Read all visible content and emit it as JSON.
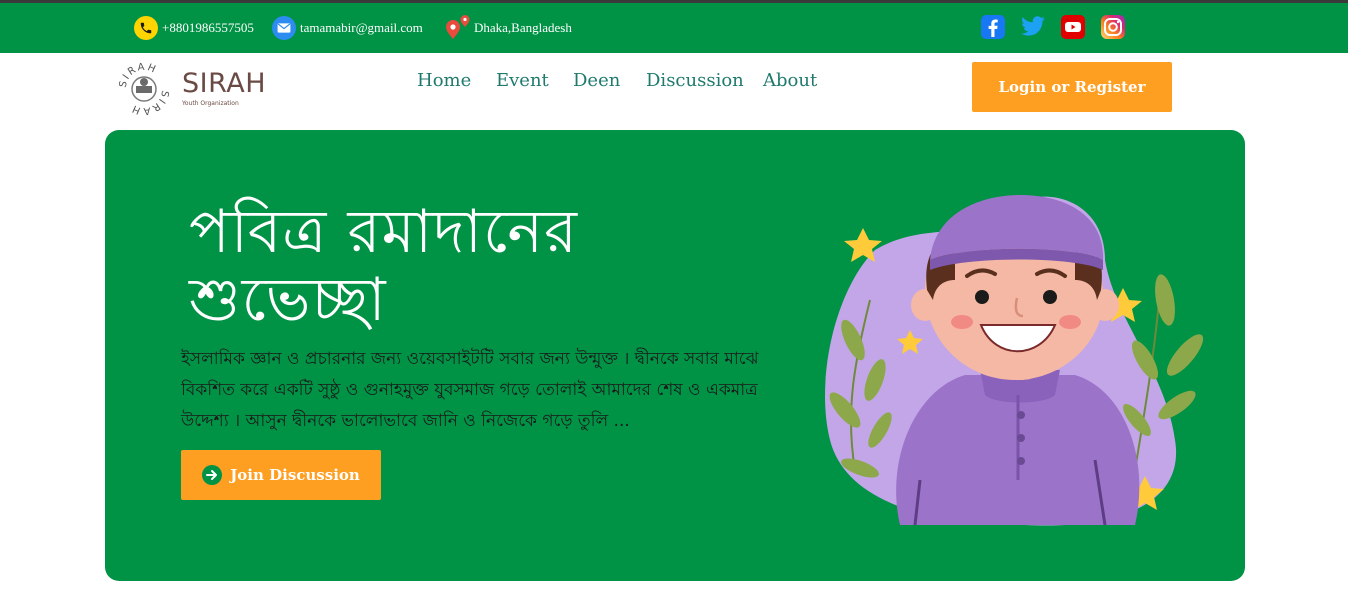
{
  "topbar": {
    "phone": "+8801986557505",
    "email": "tamamabir@gmail.com",
    "location": "Dhaka,Bangladesh",
    "social": [
      {
        "name": "facebook-icon",
        "color": "#1877f2"
      },
      {
        "name": "twitter-icon",
        "color": "#1da1f2"
      },
      {
        "name": "youtube-icon",
        "color": "#ff0000"
      },
      {
        "name": "instagram-icon",
        "color": "#e1306c"
      }
    ]
  },
  "brand": {
    "name": "SIRAH",
    "tagline": "Youth Organization",
    "seal_text": "SIRAH"
  },
  "nav": {
    "items": [
      "Home",
      "Event",
      "Deen",
      "Discussion",
      "About"
    ],
    "login_label": "Login or Register"
  },
  "hero": {
    "title_line1": "পবিত্র রমাদানের",
    "title_line2": "শুভেচ্ছা",
    "description": "ইসলামিক জ্ঞান ও প্রচারনার জন্য ওয়েবসাইটটি সবার জন্য উন্মুক্ত । দ্বীনকে সবার মাঝে বিকশিত করে একটি সুষ্ঠু ও গুনাহমুক্ত যুবসমাজ গড়ে তোলাই আমাদের শেষ ও একমাত্র উদ্দেশ্য । আসুন দ্বীনকে ভালোভাবে জানি ও নিজেকে গড়ে তুলি ...",
    "cta_label": "Join Discussion"
  },
  "colors": {
    "primary_green": "#009245",
    "accent_orange": "#ff9f22",
    "nav_text": "#1f7a6d",
    "brand_brown": "#6b4a44"
  }
}
